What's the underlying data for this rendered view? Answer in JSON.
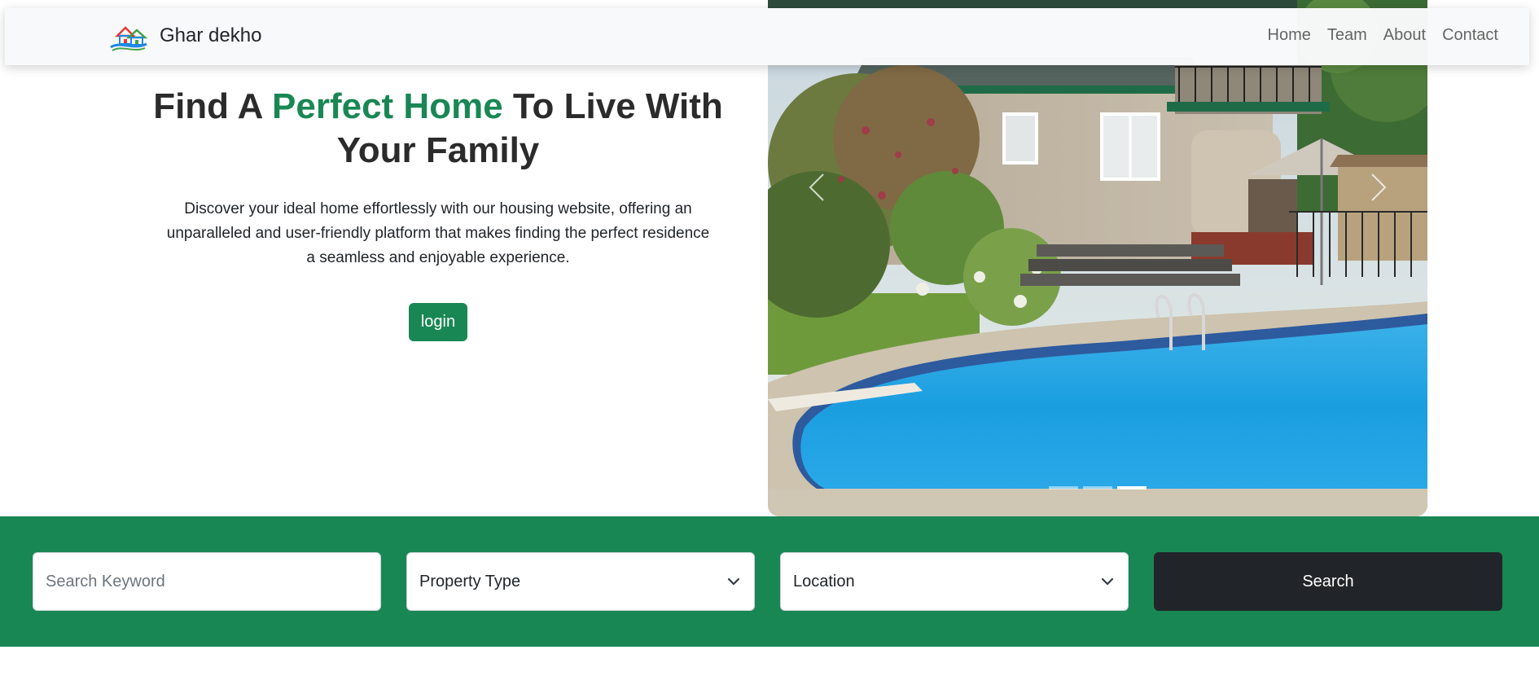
{
  "brand": {
    "name": "Ghar dekho",
    "logo_icon": "house-logo-icon"
  },
  "nav": {
    "items": [
      {
        "label": "Home"
      },
      {
        "label": "Team"
      },
      {
        "label": "About"
      },
      {
        "label": "Contact"
      }
    ]
  },
  "hero": {
    "title_part1": "Find A ",
    "title_accent": "Perfect Home",
    "title_part2": " To Live With Your Family",
    "description": "Discover your ideal home effortlessly with our housing website, offering an unparalleled and user-friendly platform that makes finding the perfect residence a seamless and enjoyable experience.",
    "login_label": "login",
    "accent_color": "#198754"
  },
  "carousel": {
    "prev_icon": "chevron-left-icon",
    "next_icon": "chevron-right-icon",
    "slide_count": 3,
    "active_slide": 2
  },
  "search": {
    "keyword_placeholder": "Search Keyword",
    "keyword_value": "",
    "property_type_selected": "Property Type",
    "location_selected": "Location",
    "button_label": "Search",
    "bar_color": "#198754",
    "button_color": "#212529"
  }
}
